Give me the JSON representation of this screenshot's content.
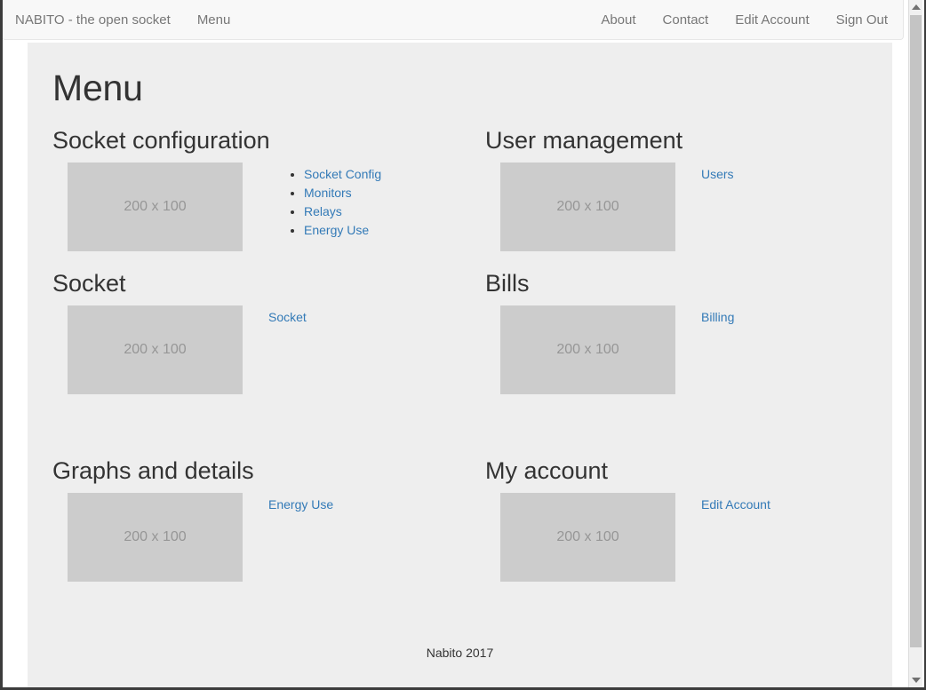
{
  "navbar": {
    "brand": "NABITO - the open socket",
    "left_items": [
      {
        "label": "Menu",
        "name": "nav-link-menu"
      }
    ],
    "right_items": [
      {
        "label": "About",
        "name": "nav-link-about"
      },
      {
        "label": "Contact",
        "name": "nav-link-contact"
      },
      {
        "label": "Edit Account",
        "name": "nav-link-edit-account"
      },
      {
        "label": "Sign Out",
        "name": "nav-link-sign-out"
      }
    ]
  },
  "page": {
    "title": "Menu",
    "thumb_label": "200 x 100"
  },
  "sections": [
    {
      "heading": "Socket configuration",
      "thumb": "200 x 100",
      "list_style": "bulleted",
      "links": [
        "Socket Config",
        "Monitors",
        "Relays",
        "Energy Use"
      ]
    },
    {
      "heading": "User management",
      "thumb": "200 x 100",
      "list_style": "plain",
      "links": [
        "Users"
      ]
    },
    {
      "heading": "Socket",
      "thumb": "200 x 100",
      "list_style": "plain",
      "links": [
        "Socket"
      ]
    },
    {
      "heading": "Bills",
      "thumb": "200 x 100",
      "list_style": "plain",
      "links": [
        "Billing"
      ]
    },
    {
      "heading": "Graphs and details",
      "thumb": "200 x 100",
      "list_style": "plain",
      "links": [
        "Energy Use"
      ]
    },
    {
      "heading": "My account",
      "thumb": "200 x 100",
      "list_style": "plain",
      "links": [
        "Edit Account"
      ]
    }
  ],
  "footer": {
    "text": "Nabito 2017"
  },
  "colors": {
    "link": "#337ab7",
    "navbar_bg": "#f8f8f8",
    "navbar_text": "#777777",
    "page_bg": "#eeeeee",
    "thumb_bg": "#cccccc",
    "heading_text": "#333333"
  },
  "scrollbar": {
    "up_arrow": "triangle-up-icon",
    "down_arrow": "triangle-down-icon"
  }
}
